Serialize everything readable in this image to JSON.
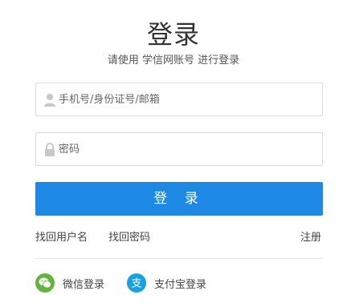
{
  "header": {
    "title": "登录",
    "subtitle": "请使用 学信网账号 进行登录"
  },
  "form": {
    "username_placeholder": "手机号/身份证号/邮箱",
    "username_value": "",
    "password_placeholder": "密码",
    "password_value": "",
    "submit_label": "登 录"
  },
  "links": {
    "find_username": "找回用户名",
    "find_password": "找回密码",
    "register": "注册"
  },
  "social": {
    "wechat_label": "微信登录",
    "alipay_label": "支付宝登录",
    "alipay_glyph": "支"
  },
  "colors": {
    "primary": "#1e88e5",
    "wechat": "#62b53c",
    "alipay": "#1a9fe0"
  }
}
